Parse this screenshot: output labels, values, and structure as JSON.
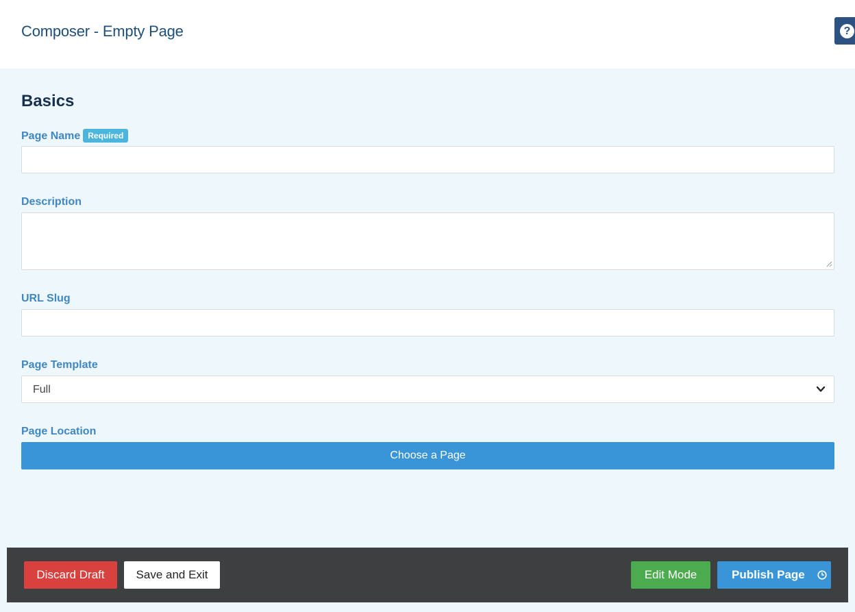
{
  "header": {
    "title": "Composer - Empty Page",
    "help_icon": "?"
  },
  "form": {
    "section_title": "Basics",
    "page_name": {
      "label": "Page Name",
      "badge": "Required",
      "value": ""
    },
    "description": {
      "label": "Description",
      "value": ""
    },
    "url_slug": {
      "label": "URL Slug",
      "value": ""
    },
    "page_template": {
      "label": "Page Template",
      "selected": "Full"
    },
    "page_location": {
      "label": "Page Location",
      "button_label": "Choose a Page"
    }
  },
  "footer": {
    "discard_label": "Discard Draft",
    "save_label": "Save and Exit",
    "edit_mode_label": "Edit Mode",
    "publish_label": "Publish Page"
  },
  "colors": {
    "accent": "#3995d8",
    "danger": "#d9413f",
    "success": "#4dab4f",
    "label": "#3f87c4",
    "badge": "#4cb5dd",
    "footer_bg": "#3d3f40"
  },
  "icons": {
    "help": "question-circle-icon",
    "dropdown": "chevron-down-icon",
    "schedule": "clock-icon"
  }
}
